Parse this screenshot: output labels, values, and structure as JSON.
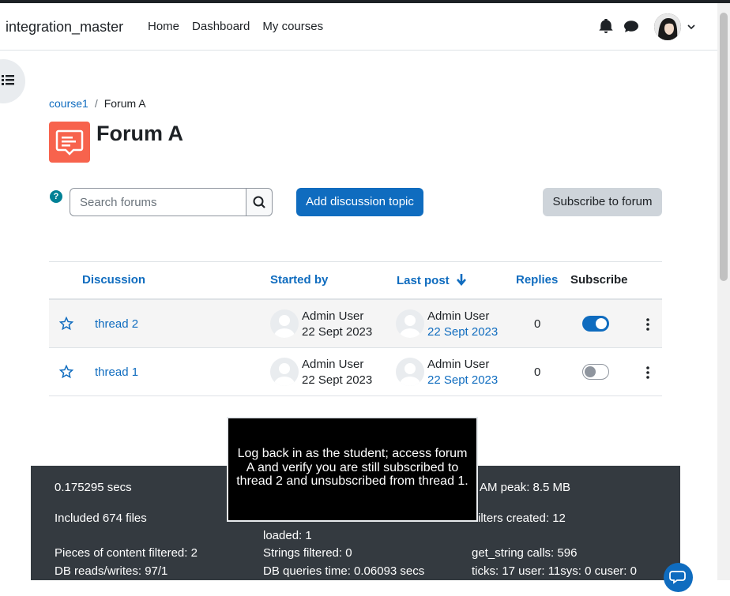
{
  "site": {
    "brand": "integration_master"
  },
  "nav": {
    "links": [
      "Home",
      "Dashboard",
      "My courses"
    ]
  },
  "breadcrumb": {
    "course": "course1",
    "current": "Forum A"
  },
  "page": {
    "title": "Forum A"
  },
  "search": {
    "placeholder": "Search forums"
  },
  "actions": {
    "add_topic": "Add discussion topic",
    "subscribe": "Subscribe to forum",
    "help": "?"
  },
  "table": {
    "headers": {
      "discussion": "Discussion",
      "started_by": "Started by",
      "last_post": "Last post",
      "replies": "Replies",
      "subscribe": "Subscribe"
    },
    "rows": [
      {
        "title": "thread 2",
        "started_name": "Admin User",
        "started_date": "22 Sept 2023",
        "last_name": "Admin User",
        "last_date": "22 Sept 2023",
        "replies": "0",
        "subscribed": true
      },
      {
        "title": "thread 1",
        "started_name": "Admin User",
        "started_date": "22 Sept 2023",
        "last_name": "Admin User",
        "last_date": "22 Sept 2023",
        "replies": "0",
        "subscribed": false
      }
    ]
  },
  "footer": {
    "secs": "0.175295 secs",
    "ram": "AM peak: 8.5 MB",
    "files": "Included 674 files",
    "filters_created": "ilters created: 12",
    "loaded": "loaded: 1",
    "content_filtered": "Pieces of content filtered: 2",
    "strings_filtered": "Strings filtered: 0",
    "get_string": "get_string calls: 596",
    "db_rw": "DB reads/writes: 97/1",
    "db_time": "DB queries time: 0.06093 secs",
    "ticks": "ticks: 17 user: 11sys: 0 cuser: 0"
  },
  "tooltip": {
    "text": "Log back in as the student; access forum A and verify you are still subscribed to thread 2 and unsubscribed from thread 1."
  },
  "colors": {
    "primary": "#0f6cbf",
    "forum_icon": "#f7634d",
    "footer_bg": "#343a40"
  }
}
